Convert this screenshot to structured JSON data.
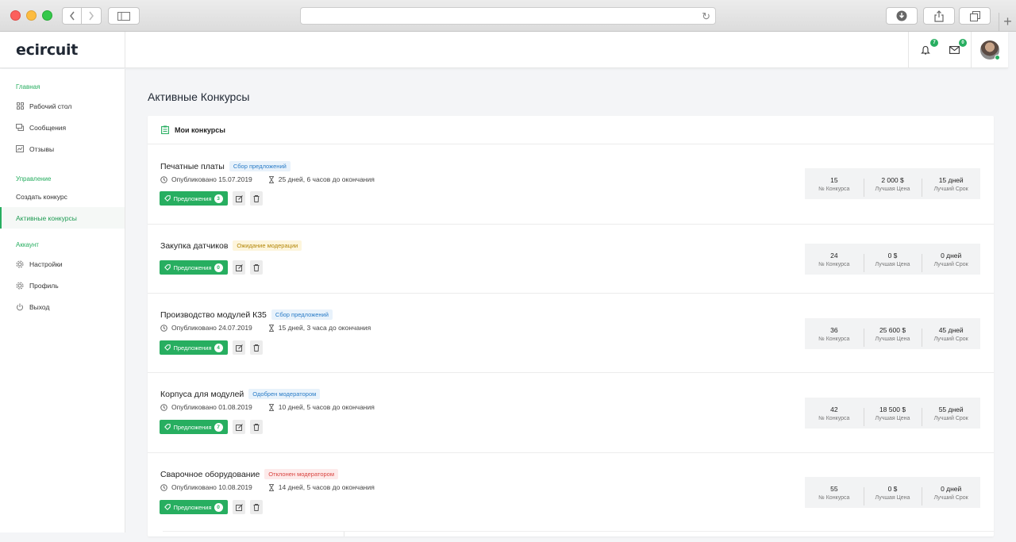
{
  "app": {
    "logo": "ecircuit",
    "notifications_count": "7",
    "messages_count": "0"
  },
  "sidebar": {
    "sections": [
      {
        "title": "Главная",
        "items": [
          {
            "label": "Рабочий стол",
            "icon": "grid-icon"
          },
          {
            "label": "Сообщения",
            "icon": "chat-icon"
          },
          {
            "label": "Отзывы",
            "icon": "review-icon"
          }
        ]
      },
      {
        "title": "Управление",
        "items": [
          {
            "label": "Создать конкурс"
          },
          {
            "label": "Активные конкурсы",
            "active": true
          }
        ]
      },
      {
        "title": "Аккаунт",
        "items": [
          {
            "label": "Настройки",
            "icon": "gear-icon"
          },
          {
            "label": "Профиль",
            "icon": "gear-icon"
          },
          {
            "label": "Выход",
            "icon": "power-icon"
          }
        ]
      }
    ]
  },
  "page": {
    "title": "Активные Конкурсы",
    "panel_title": "Мои конкурсы",
    "offers_label": "Предложения",
    "stat_labels": {
      "number": "№ Конкурса",
      "price": "Лучшая Цена",
      "term": "Лучший Срок"
    }
  },
  "contests": [
    {
      "title": "Печатные платы",
      "status": "Сбор предложений",
      "status_color": "blue",
      "published": "Опубликовано 15.07.2019",
      "remaining": "25 дней, 6 часов до окончания",
      "offers": "3",
      "number": "15",
      "best_price": "2 000 $",
      "best_term": "15 дней"
    },
    {
      "title": "Закупка датчиков",
      "status": "Ожидание модерации",
      "status_color": "yellow",
      "published": "",
      "remaining": "",
      "offers": "0",
      "number": "24",
      "best_price": "0 $",
      "best_term": "0 дней"
    },
    {
      "title": "Производство модулей К35",
      "status": "Сбор предложений",
      "status_color": "blue",
      "published": "Опубликовано 24.07.2019",
      "remaining": "15 дней, 3 часа до окончания",
      "offers": "4",
      "number": "36",
      "best_price": "25 600 $",
      "best_term": "45 дней"
    },
    {
      "title": "Корпуса для модулей",
      "status": "Одобрен модератором",
      "status_color": "blue",
      "published": "Опубликовано 01.08.2019",
      "remaining": "10 дней, 5 часов до окончания",
      "offers": "7",
      "number": "42",
      "best_price": "18 500 $",
      "best_term": "55 дней"
    },
    {
      "title": "Сварочное оборудование",
      "status": "Отклонен модератором",
      "status_color": "red",
      "published": "Опубликовано 10.08.2019",
      "remaining": "14 дней, 5 часов до окончания",
      "offers": "0",
      "number": "55",
      "best_price": "0 $",
      "best_term": "0 дней"
    }
  ]
}
